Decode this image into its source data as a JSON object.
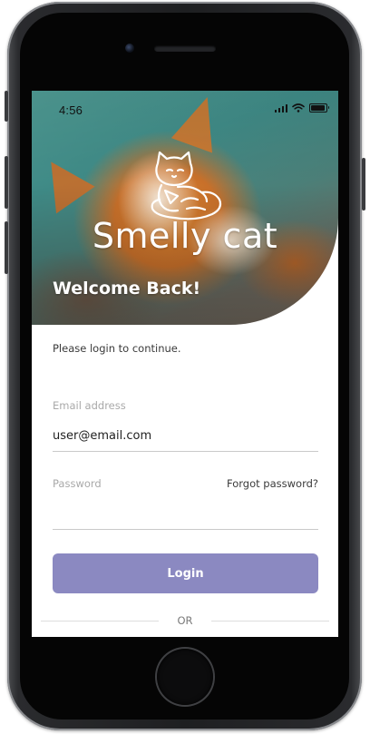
{
  "status_bar": {
    "time": "4:56"
  },
  "brand": {
    "name": "Smelly cat"
  },
  "header": {
    "welcome": "Welcome Back!"
  },
  "form": {
    "subtitle": "Please login to continue.",
    "email": {
      "label": "Email address",
      "value": "user@email.com"
    },
    "password": {
      "label": "Password",
      "value": "",
      "forgot_label": "Forgot password?"
    },
    "login_label": "Login",
    "divider_label": "OR"
  },
  "colors": {
    "accent": "#8b89c1",
    "field_label": "#a9a9a9",
    "text": "#1f1f1f"
  }
}
